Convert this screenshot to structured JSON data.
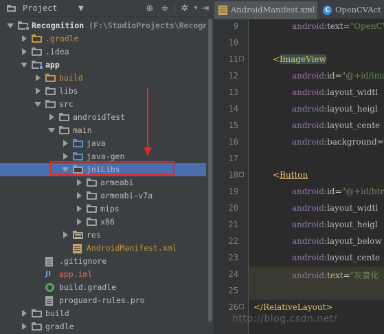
{
  "project_pane": {
    "view_title": "Project",
    "tree": [
      {
        "label": "Recognition",
        "suffix": " (F:\\StudioProjects\\Recogniti",
        "icon": "module-folder-icon",
        "expanded": true
      },
      {
        "label": ".gradle",
        "icon": "folder-icon",
        "expanded": false
      },
      {
        "label": ".idea",
        "icon": "folder-icon",
        "expanded": false
      },
      {
        "label": "app",
        "icon": "module-folder-icon",
        "expanded": true
      },
      {
        "label": "build",
        "icon": "folder-icon",
        "expanded": false
      },
      {
        "label": "libs",
        "icon": "folder-icon",
        "expanded": false
      },
      {
        "label": "src",
        "icon": "folder-icon",
        "expanded": true
      },
      {
        "label": "androidTest",
        "icon": "folder-icon",
        "expanded": false
      },
      {
        "label": "main",
        "icon": "folder-icon",
        "expanded": true
      },
      {
        "label": "java",
        "icon": "source-folder-icon",
        "expanded": false
      },
      {
        "label": "java-gen",
        "icon": "source-folder-icon",
        "expanded": false
      },
      {
        "label": "jniLibs",
        "icon": "folder-icon",
        "expanded": true,
        "selected": true
      },
      {
        "label": "armeabi",
        "icon": "folder-icon",
        "expanded": false
      },
      {
        "label": "armeabi-v7a",
        "icon": "folder-icon",
        "expanded": false
      },
      {
        "label": "mips",
        "icon": "folder-icon",
        "expanded": false
      },
      {
        "label": "x86",
        "icon": "folder-icon",
        "expanded": false
      },
      {
        "label": "res",
        "icon": "resource-folder-icon",
        "expanded": false
      },
      {
        "label": "AndroidManifest.xml",
        "icon": "xml-file-icon"
      },
      {
        "label": ".gitignore",
        "icon": "text-file-icon"
      },
      {
        "label": "app.iml",
        "icon": "iml-file-icon"
      },
      {
        "label": "build.gradle",
        "icon": "gradle-file-icon"
      },
      {
        "label": "proguard-rules.pro",
        "icon": "text-file-icon"
      },
      {
        "label": "build",
        "icon": "folder-icon",
        "expanded": false
      },
      {
        "label": "gradle",
        "icon": "folder-icon",
        "expanded": false
      }
    ]
  },
  "editor": {
    "tabs": [
      {
        "label": "AndroidManifest.xml",
        "active": true
      },
      {
        "label": "OpenCVAct",
        "active": false
      }
    ],
    "lines": [
      {
        "n": "9",
        "code": [
          [
            "ns",
            "android"
          ],
          [
            "at",
            ":text="
          ],
          [
            "val",
            "\"OpenCV"
          ]
        ]
      },
      {
        "n": "10",
        "code": []
      },
      {
        "n": "11",
        "code": [
          [
            "br",
            "<"
          ],
          [
            "tagname-hl",
            "ImageView"
          ]
        ]
      },
      {
        "n": "12",
        "code": [
          [
            "ns",
            "android"
          ],
          [
            "at",
            ":id="
          ],
          [
            "val",
            "\"@+id/ima"
          ]
        ]
      },
      {
        "n": "13",
        "code": [
          [
            "ns",
            "android"
          ],
          [
            "at",
            ":layout_widtl"
          ]
        ]
      },
      {
        "n": "14",
        "code": [
          [
            "ns",
            "android"
          ],
          [
            "at",
            ":layout_heigl"
          ]
        ]
      },
      {
        "n": "15",
        "code": [
          [
            "ns",
            "android"
          ],
          [
            "at",
            ":layout_cente"
          ]
        ]
      },
      {
        "n": "16",
        "code": [
          [
            "ns",
            "android"
          ],
          [
            "at",
            ":background="
          ]
        ]
      },
      {
        "n": "17",
        "code": []
      },
      {
        "n": "18",
        "code": [
          [
            "br",
            "<"
          ],
          [
            "tagname-lk",
            "Button"
          ]
        ]
      },
      {
        "n": "19",
        "code": [
          [
            "ns",
            "android"
          ],
          [
            "at",
            ":id="
          ],
          [
            "val",
            "\"@+id/btr"
          ]
        ]
      },
      {
        "n": "20",
        "code": [
          [
            "ns",
            "android"
          ],
          [
            "at",
            ":layout_widtl"
          ]
        ]
      },
      {
        "n": "21",
        "code": [
          [
            "ns",
            "android"
          ],
          [
            "at",
            ":layout_heigl"
          ]
        ]
      },
      {
        "n": "22",
        "code": [
          [
            "ns",
            "android"
          ],
          [
            "at",
            ":layout_below"
          ]
        ]
      },
      {
        "n": "23",
        "code": [
          [
            "ns",
            "android"
          ],
          [
            "at",
            ":layout_cente"
          ]
        ]
      },
      {
        "n": "24",
        "code": [
          [
            "ns",
            "android"
          ],
          [
            "at",
            ":text="
          ],
          [
            "val",
            "\"灰度化"
          ]
        ]
      },
      {
        "n": "25",
        "code": []
      },
      {
        "n": "26",
        "code": [
          [
            "br",
            "</"
          ],
          [
            "tag",
            "RelativeLayout"
          ],
          [
            "br",
            ">"
          ]
        ]
      }
    ]
  },
  "watermark": "http://blog.csdn.net/",
  "colors": {
    "selection": "#4b6eaf",
    "annotation": "#e0292a"
  }
}
